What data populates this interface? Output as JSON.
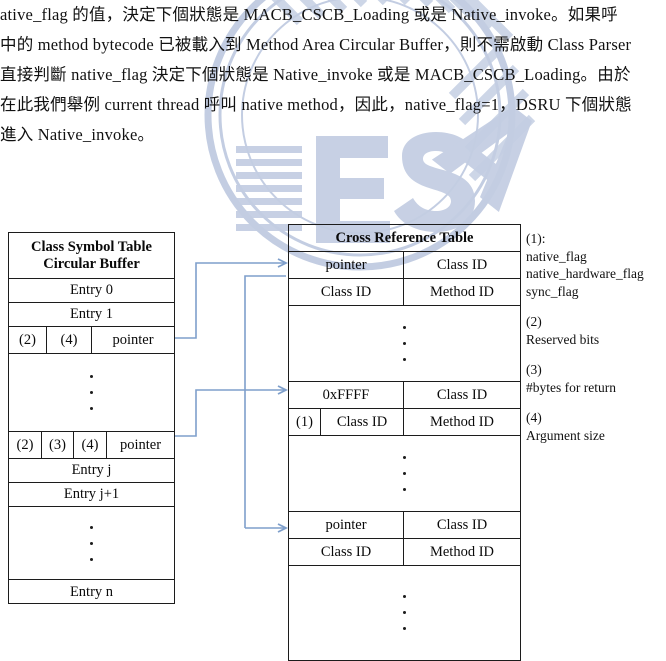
{
  "page": {
    "body_text_lines": [
      "ative_flag 的值，決定下個狀態是 MACB_CSCB_Loading 或是 Native_invoke。如果呼",
      "中的 method bytecode 已被載入到 Method Area Circular Buffer，則不需啟動 Class Parser",
      "直接判斷 native_flag 決定下個狀態是 Native_invoke 或是 MACB_CSCB_Loading。由於",
      "在此我們舉例 current thread 呼叫 native method，因此，native_flag=1，DSRU 下個狀態",
      "進入 Native_invoke。"
    ],
    "watermark_text": "IES"
  },
  "diagram": {
    "left_table": {
      "header": {
        "line1": "Class Symbol Table",
        "line2": "Circular Buffer"
      },
      "rows": [
        {
          "type": "single",
          "label": "Entry 0"
        },
        {
          "type": "single",
          "label": "Entry 1"
        },
        {
          "type": "split3",
          "cells": [
            "(2)",
            "(4)",
            "pointer"
          ]
        },
        {
          "type": "dots"
        },
        {
          "type": "split4",
          "cells": [
            "(2)",
            "(3)",
            "(4)",
            "pointer"
          ]
        },
        {
          "type": "single",
          "label": "Entry j"
        },
        {
          "type": "single",
          "label": "Entry j+1"
        },
        {
          "type": "dots"
        },
        {
          "type": "single",
          "label": "Entry n"
        }
      ]
    },
    "right_table": {
      "header": "Cross Reference Table",
      "rows": [
        {
          "type": "pair",
          "left": "pointer",
          "right": "Class ID"
        },
        {
          "type": "pair",
          "left": "Class ID",
          "right": "Method ID"
        },
        {
          "type": "dots"
        },
        {
          "type": "pair",
          "left": "0xFFFF",
          "right": "Class ID"
        },
        {
          "type": "triple",
          "tag": "(1)",
          "left": "Class ID",
          "right": "Method ID"
        },
        {
          "type": "dots"
        },
        {
          "type": "pair",
          "left": "pointer",
          "right": "Class ID"
        },
        {
          "type": "pair",
          "left": "Class ID",
          "right": "Method ID"
        },
        {
          "type": "dots"
        }
      ]
    },
    "legend": [
      {
        "marker": "(1):",
        "items": [
          "native_flag",
          "native_hardware_flag",
          "sync_flag"
        ]
      },
      {
        "marker": "(2)",
        "items": [
          "Reserved bits"
        ]
      },
      {
        "marker": "(3)",
        "items": [
          "#bytes for return"
        ]
      },
      {
        "marker": "(4)",
        "items": [
          "Argument size"
        ]
      }
    ],
    "colors": {
      "connector": "#7f9fcb",
      "border": "#1c1c1c",
      "watermark": "#93a6cb"
    }
  }
}
